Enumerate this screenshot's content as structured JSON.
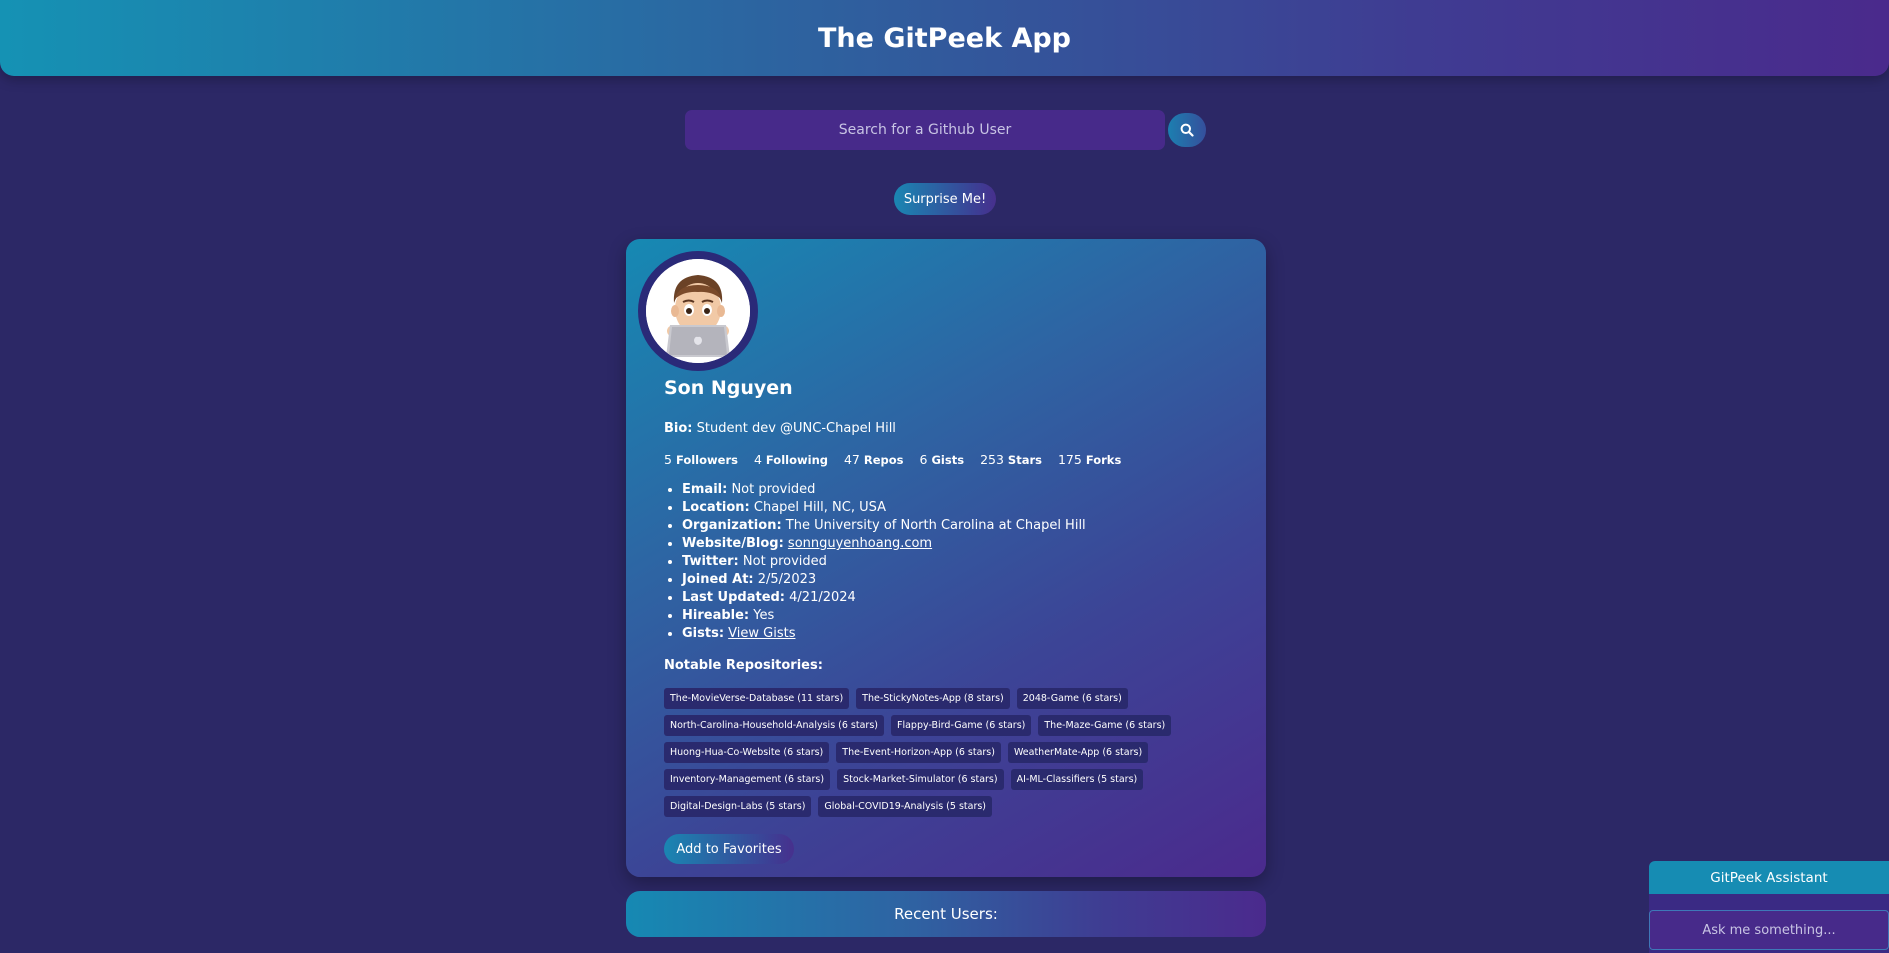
{
  "app": {
    "title": "The GitPeek App"
  },
  "search": {
    "placeholder": "Search for a Github User",
    "icon": "search-icon"
  },
  "surprise_label": "Surprise Me!",
  "profile": {
    "name": "Son Nguyen",
    "bio_label": "Bio:",
    "bio": "Student dev @UNC-Chapel Hill",
    "stats": [
      {
        "value": "5",
        "label": "Followers"
      },
      {
        "value": "4",
        "label": "Following"
      },
      {
        "value": "47",
        "label": "Repos"
      },
      {
        "value": "6",
        "label": "Gists"
      },
      {
        "value": "253",
        "label": "Stars"
      },
      {
        "value": "175",
        "label": "Forks"
      }
    ],
    "details": [
      {
        "label": "Email:",
        "value": "Not provided"
      },
      {
        "label": "Location:",
        "value": "Chapel Hill, NC, USA"
      },
      {
        "label": "Organization:",
        "value": "The University of North Carolina at Chapel Hill"
      },
      {
        "label": "Website/Blog:",
        "value": "sonnguyenhoang.com"
      },
      {
        "label": "Twitter:",
        "value": "Not provided"
      },
      {
        "label": "Joined At:",
        "value": "2/5/2023"
      },
      {
        "label": "Last Updated:",
        "value": "4/21/2024"
      },
      {
        "label": "Hireable:",
        "value": "Yes"
      },
      {
        "label": "Gists:",
        "value": "View Gists"
      }
    ],
    "notable_title": "Notable Repositories:",
    "repos": [
      "The-MovieVerse-Database (11 stars)",
      "The-StickyNotes-App (8 stars)",
      "2048-Game (6 stars)",
      "North-Carolina-Household-Analysis (6 stars)",
      "Flappy-Bird-Game (6 stars)",
      "The-Maze-Game (6 stars)",
      "Huong-Hua-Co-Website (6 stars)",
      "The-Event-Horizon-App (6 stars)",
      "WeatherMate-App (6 stars)",
      "Inventory-Management (6 stars)",
      "Stock-Market-Simulator (6 stars)",
      "AI-ML-Classifiers (5 stars)",
      "Digital-Design-Labs (5 stars)",
      "Global-COVID19-Analysis (5 stars)"
    ],
    "favorite_label": "Add to Favorites"
  },
  "recent_title": "Recent Users:",
  "assistant": {
    "title": "GitPeek Assistant",
    "placeholder": "Ask me something..."
  }
}
